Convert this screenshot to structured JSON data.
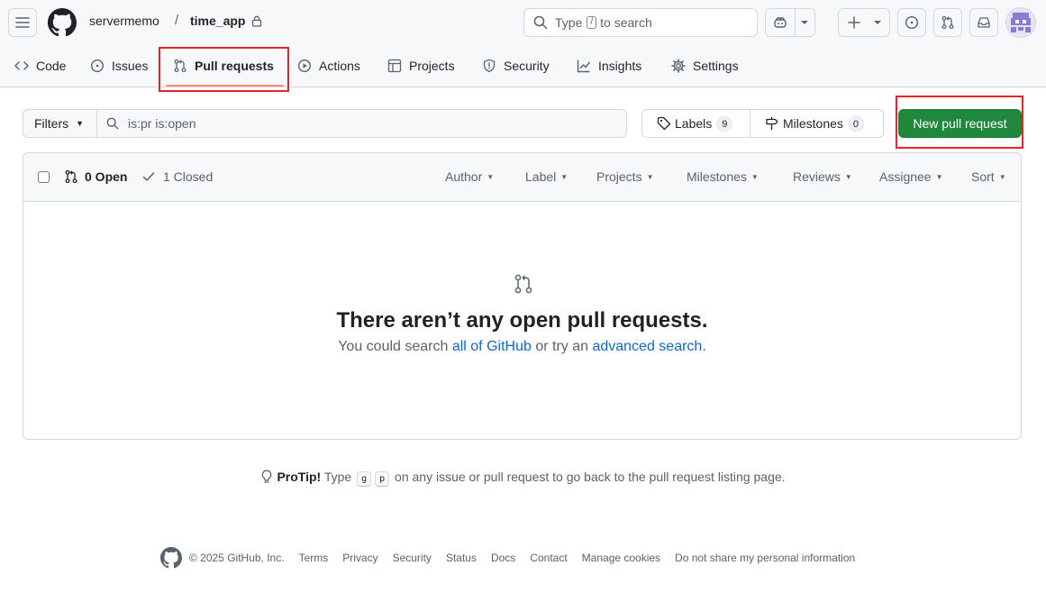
{
  "header": {
    "owner": "servermemo",
    "separator": "/",
    "repo": "time_app",
    "search_placeholder_pre": "Type",
    "search_key": "/",
    "search_placeholder_post": "to search"
  },
  "nav": {
    "code": "Code",
    "issues": "Issues",
    "pull_requests": "Pull requests",
    "actions": "Actions",
    "projects": "Projects",
    "security": "Security",
    "insights": "Insights",
    "settings": "Settings"
  },
  "toolbar": {
    "filters_label": "Filters",
    "filter_query": "is:pr is:open",
    "labels_label": "Labels",
    "labels_count": "9",
    "milestones_label": "Milestones",
    "milestones_count": "0",
    "new_pr_label": "New pull request"
  },
  "list": {
    "open_label": "0 Open",
    "closed_label": "1 Closed",
    "menus": {
      "author": "Author",
      "label": "Label",
      "projects": "Projects",
      "milestones": "Milestones",
      "reviews": "Reviews",
      "assignee": "Assignee",
      "sort": "Sort"
    }
  },
  "blankslate": {
    "title": "There aren’t any open pull requests.",
    "text_pre": "You could search ",
    "link_all": "all of GitHub",
    "text_mid": " or try an ",
    "link_advanced": "advanced search",
    "text_post": "."
  },
  "protip": {
    "label": "ProTip!",
    "pre": " Type ",
    "key1": "g",
    "key2": "p",
    "post": " on any issue or pull request to go back to the pull request listing page."
  },
  "footer": {
    "copyright": "© 2025 GitHub, Inc.",
    "links": [
      "Terms",
      "Privacy",
      "Security",
      "Status",
      "Docs",
      "Contact",
      "Manage cookies",
      "Do not share my personal information"
    ]
  },
  "colors": {
    "accent": "#1f883d",
    "link": "#0969da",
    "selected_underline": "#fd8c73",
    "highlight_box": "#e5252a"
  }
}
